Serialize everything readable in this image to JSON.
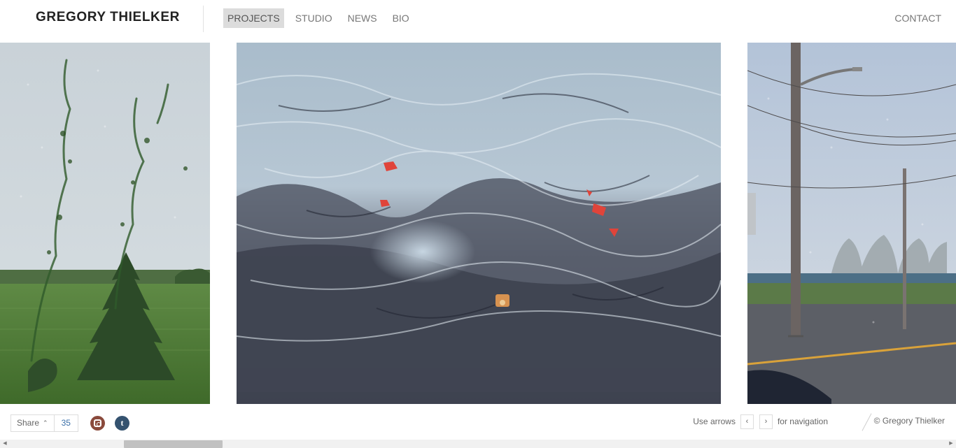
{
  "site": {
    "title": "GREGORY THIELKER"
  },
  "nav": {
    "items": [
      {
        "label": "PROJECTS",
        "active": true
      },
      {
        "label": "STUDIO",
        "active": false
      },
      {
        "label": "NEWS",
        "active": false
      },
      {
        "label": "BIO",
        "active": false
      }
    ],
    "contact": "CONTACT"
  },
  "gallery": {
    "slides": [
      {
        "name": "painting-rain-window-marsh",
        "icon": "image"
      },
      {
        "name": "painting-rain-windshield-traffic",
        "icon": "image"
      },
      {
        "name": "painting-rain-window-utility-pole",
        "icon": "image"
      }
    ]
  },
  "footer": {
    "share_label": "Share",
    "share_count": "35",
    "social": [
      {
        "name": "instagram-icon",
        "color": "#8a4a3c"
      },
      {
        "name": "tumblr-icon",
        "color": "#34526f",
        "glyph": "t"
      }
    ],
    "nav_hint": {
      "prefix": "Use arrows",
      "prev_glyph": "‹",
      "next_glyph": "›",
      "suffix": "for navigation"
    },
    "copyright": "© Gregory Thielker"
  },
  "scrollbar": {
    "left_arrow": "◀",
    "right_arrow": "▶"
  }
}
